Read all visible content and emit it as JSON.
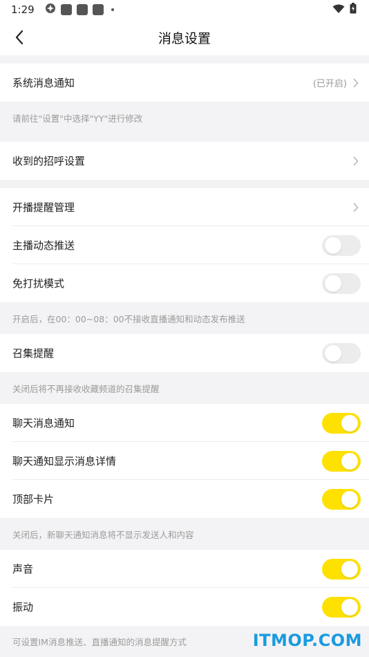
{
  "status_bar": {
    "time": "1:29"
  },
  "header": {
    "title": "消息设置"
  },
  "sections": {
    "system_notify": {
      "label": "系统消息通知",
      "value": "(已开启)"
    },
    "system_note": "请前往\"设置\"中选择\"YY\"进行修改",
    "greeting": {
      "label": "收到的招呼设置"
    },
    "live_reminder": {
      "label": "开播提醒管理"
    },
    "anchor_push": {
      "label": "主播动态推送",
      "enabled": false
    },
    "dnd": {
      "label": "免打扰模式",
      "enabled": false
    },
    "dnd_note": "开启后，在00：00~08：00不接收直播通知和动态发布推送",
    "summon": {
      "label": "召集提醒",
      "enabled": false
    },
    "summon_note": "关闭后将不再接收收藏频道的召集提醒",
    "chat_notify": {
      "label": "聊天消息通知",
      "enabled": true
    },
    "chat_detail": {
      "label": "聊天通知显示消息详情",
      "enabled": true
    },
    "top_card": {
      "label": "顶部卡片",
      "enabled": true
    },
    "chat_note": "关闭后，新聊天通知消息将不显示发送人和内容",
    "sound": {
      "label": "声音",
      "enabled": true
    },
    "vibrate": {
      "label": "振动",
      "enabled": true
    },
    "im_note": "可设置IM消息推送、直播通知的消息提醒方式"
  },
  "watermark": "ITMOP.COM",
  "colors": {
    "toggle_on": "#ffe100",
    "toggle_off": "#ececec",
    "watermark": "#1a9be0"
  }
}
